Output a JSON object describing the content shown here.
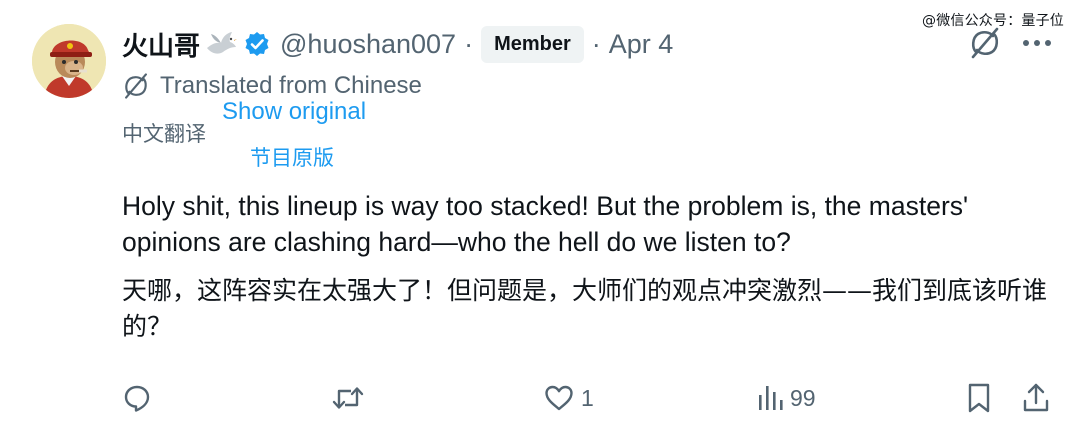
{
  "watermark": "@微信公众号：量子位",
  "author": {
    "display_name": "火山哥",
    "handle": "@huoshan007",
    "separator": "·",
    "badge": "Member",
    "date_separator": "·",
    "date": "Apr 4"
  },
  "translation": {
    "notice": "Translated from Chinese",
    "notice_cn": "中文翻译",
    "show_original": "Show original",
    "show_original_cn": "节目原版"
  },
  "body": {
    "english": "Holy shit, this lineup is way too stacked! But the problem is, the masters' opinions are clashing hard—who the hell do we listen to?",
    "chinese": "天哪，这阵容实在太强大了！但问题是，大师们的观点冲突激烈——我们到底该听谁的？"
  },
  "actions": {
    "reply_count": "",
    "retweet_count": "",
    "like_count": "1",
    "view_count": "99"
  },
  "icons": {
    "avatar": "avatar-image",
    "dove": "dove-icon",
    "verified": "verified-badge-icon",
    "grok": "grok-icon",
    "more": "more-icon",
    "translate": "translate-icon",
    "reply": "reply-icon",
    "retweet": "retweet-icon",
    "like": "heart-icon",
    "views": "views-icon",
    "bookmark": "bookmark-icon",
    "share": "share-icon"
  },
  "colors": {
    "text": "#0f1419",
    "secondary": "#536471",
    "accent": "#1d9bf0",
    "badge_bg": "#eff3f4",
    "verified": "#1d9bf0"
  }
}
